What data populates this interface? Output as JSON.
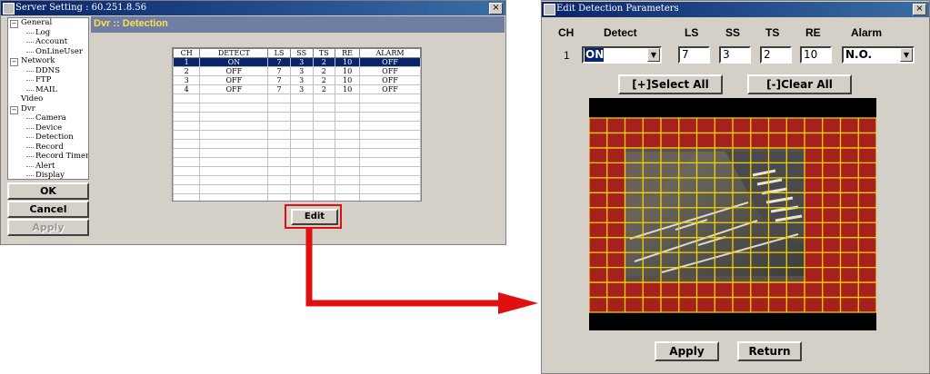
{
  "server_window": {
    "title": "Server Setting : 60.251.8.56",
    "close": "×",
    "panel_title": "Dvr :: Detection",
    "tree": [
      {
        "label": "General",
        "level": 0,
        "exp": "−"
      },
      {
        "label": "Log",
        "level": 1
      },
      {
        "label": "Account",
        "level": 1
      },
      {
        "label": "OnLineUser",
        "level": 1
      },
      {
        "label": "Network",
        "level": 0,
        "exp": "−"
      },
      {
        "label": "DDNS",
        "level": 1
      },
      {
        "label": "FTP",
        "level": 1
      },
      {
        "label": "MAIL",
        "level": 1
      },
      {
        "label": "Video",
        "level": 0
      },
      {
        "label": "Dvr",
        "level": 0,
        "exp": "−"
      },
      {
        "label": "Camera",
        "level": 1
      },
      {
        "label": "Device",
        "level": 1
      },
      {
        "label": "Detection",
        "level": 1
      },
      {
        "label": "Record",
        "level": 1
      },
      {
        "label": "Record Timer",
        "level": 1
      },
      {
        "label": "Alert",
        "level": 1
      },
      {
        "label": "Display",
        "level": 1
      }
    ],
    "ok_label": "OK",
    "cancel_label": "Cancel",
    "apply_label": "Apply",
    "edit_label": "Edit",
    "table": {
      "columns": [
        "CH",
        "DETECT",
        "LS",
        "SS",
        "TS",
        "RE",
        "ALARM"
      ],
      "rows": [
        [
          "1",
          "ON",
          "7",
          "3",
          "2",
          "10",
          "OFF"
        ],
        [
          "2",
          "OFF",
          "7",
          "3",
          "2",
          "10",
          "OFF"
        ],
        [
          "3",
          "OFF",
          "7",
          "3",
          "2",
          "10",
          "OFF"
        ],
        [
          "4",
          "OFF",
          "7",
          "3",
          "2",
          "10",
          "OFF"
        ]
      ],
      "selected_row": 0
    }
  },
  "edit_window": {
    "title": "Edit Detection Parameters",
    "close": "×",
    "headers": {
      "ch": "CH",
      "detect": "Detect",
      "ls": "LS",
      "ss": "SS",
      "ts": "TS",
      "re": "RE",
      "alarm": "Alarm"
    },
    "ch_value": "1",
    "detect_value": "ON",
    "ls_value": "7",
    "ss_value": "3",
    "ts_value": "2",
    "re_value": "10",
    "alarm_value": "N.O.",
    "select_all_label": "[+]Select All",
    "clear_all_label": "[-]Clear All",
    "apply_label": "Apply",
    "return_label": "Return",
    "grid": {
      "cols": 16,
      "rows": 13,
      "grid_color": "#f2d400",
      "mask_color": "#b41818"
    }
  },
  "colors": {
    "arrow": "#e01010",
    "highlight_box": "#e01010",
    "title_bar": "#0a246a",
    "panel_header": "#6f7ea2",
    "panel_header_text": "#ffe24a"
  }
}
